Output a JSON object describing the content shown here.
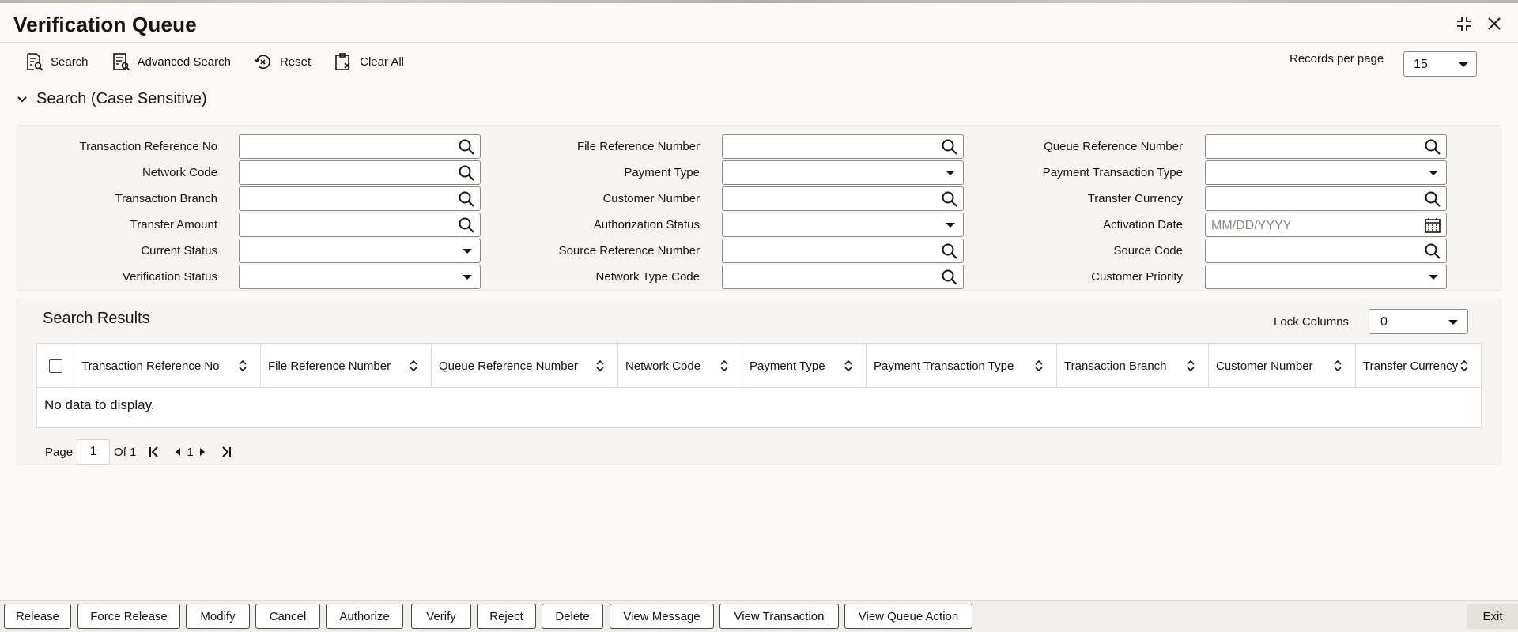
{
  "window": {
    "title": "Verification Queue",
    "icons": [
      "collapse-icon",
      "close-icon"
    ]
  },
  "toolbar": {
    "search": "Search",
    "advanced_search": "Advanced Search",
    "reset": "Reset",
    "clear_all": "Clear All",
    "records_per_page_label": "Records per page",
    "records_per_page_value": "15"
  },
  "search_section": {
    "title": "Search (Case Sensitive)",
    "fields": [
      {
        "label": "Transaction Reference No",
        "value": "",
        "kind": "lookup"
      },
      {
        "label": "File Reference Number",
        "value": "",
        "kind": "lookup"
      },
      {
        "label": "Queue Reference Number",
        "value": "",
        "kind": "lookup"
      },
      {
        "label": "Network Code",
        "value": "",
        "kind": "lookup"
      },
      {
        "label": "Payment Type",
        "value": "",
        "kind": "select"
      },
      {
        "label": "Payment Transaction Type",
        "value": "",
        "kind": "select"
      },
      {
        "label": "Transaction Branch",
        "value": "",
        "kind": "lookup"
      },
      {
        "label": "Customer Number",
        "value": "",
        "kind": "lookup"
      },
      {
        "label": "Transfer Currency",
        "value": "",
        "kind": "lookup"
      },
      {
        "label": "Transfer Amount",
        "value": "",
        "kind": "lookup"
      },
      {
        "label": "Authorization Status",
        "value": "",
        "kind": "select"
      },
      {
        "label": "Activation Date",
        "value": "",
        "placeholder": "MM/DD/YYYY",
        "kind": "date"
      },
      {
        "label": "Current Status",
        "value": "",
        "kind": "select"
      },
      {
        "label": "Source Reference Number",
        "value": "",
        "kind": "lookup"
      },
      {
        "label": "Source Code",
        "value": "",
        "kind": "lookup"
      },
      {
        "label": "Verification Status",
        "value": "",
        "kind": "select"
      },
      {
        "label": "Network Type Code",
        "value": "",
        "kind": "lookup"
      },
      {
        "label": "Customer Priority",
        "value": "",
        "kind": "select"
      }
    ]
  },
  "results": {
    "title": "Search Results",
    "lock_columns_label": "Lock Columns",
    "lock_columns_value": "0",
    "columns": [
      "Transaction Reference No",
      "File Reference Number",
      "Queue Reference Number",
      "Network Code",
      "Payment Type",
      "Payment Transaction Type",
      "Transaction Branch",
      "Customer Number",
      "Transfer Currency"
    ],
    "empty_message": "No data to display."
  },
  "pager": {
    "page_label": "Page",
    "page_value": "1",
    "of_label": "Of 1",
    "current": "1"
  },
  "actions": {
    "buttons": [
      "Release",
      "Force Release",
      "Modify",
      "Cancel",
      "Authorize",
      "Verify",
      "Reject",
      "Delete",
      "View Message",
      "View Transaction",
      "View Queue Action"
    ],
    "exit": "Exit"
  }
}
